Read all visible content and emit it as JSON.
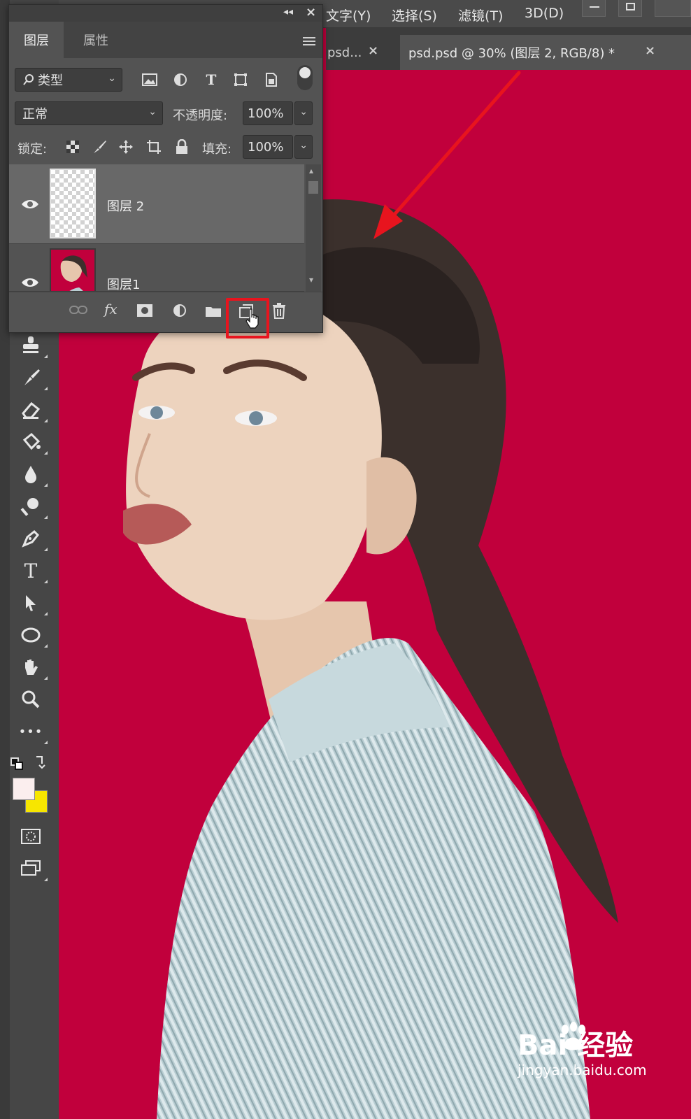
{
  "menu": {
    "items": [
      "文字(Y)",
      "选择(S)",
      "滤镜(T)",
      "3D(D)"
    ]
  },
  "tabs": {
    "inactive_label": "psd...",
    "active_label": "psd.psd @ 30% (图层 2, RGB/8) *",
    "close_glyph": "×"
  },
  "panel": {
    "tab_layers": "图层",
    "tab_properties": "属性",
    "filter_kind": "类型",
    "blend_mode": "正常",
    "opacity_label": "不透明度:",
    "opacity_value": "100%",
    "lock_label": "锁定:",
    "fill_label": "填充:",
    "fill_value": "100%",
    "layers": [
      {
        "name": "图层 2",
        "selected": true
      },
      {
        "name": "图层1",
        "selected": false
      }
    ],
    "footer_icons": [
      "link-icon",
      "fx-icon",
      "mask-icon",
      "adjustment-icon",
      "folder-icon",
      "new-layer-icon",
      "trash-icon"
    ],
    "fx_text": "fx"
  },
  "toolbar": {
    "tools": [
      "stamp-icon",
      "history-brush-icon",
      "eraser-icon",
      "paint-bucket-icon",
      "blur-icon",
      "dodge-icon",
      "pen-icon",
      "type-icon",
      "path-select-icon",
      "ellipse-icon",
      "hand-icon",
      "zoom-icon",
      "more-icon"
    ],
    "type_glyph": "T",
    "more_glyph": "•••"
  },
  "colors": {
    "canvas_bg": "#c1003c",
    "foreground": "#fbeeee",
    "background": "#f7e600",
    "highlight": "#e8141e"
  },
  "watermark": {
    "text": "Bai 经验",
    "url": "jingyan.baidu.com"
  }
}
